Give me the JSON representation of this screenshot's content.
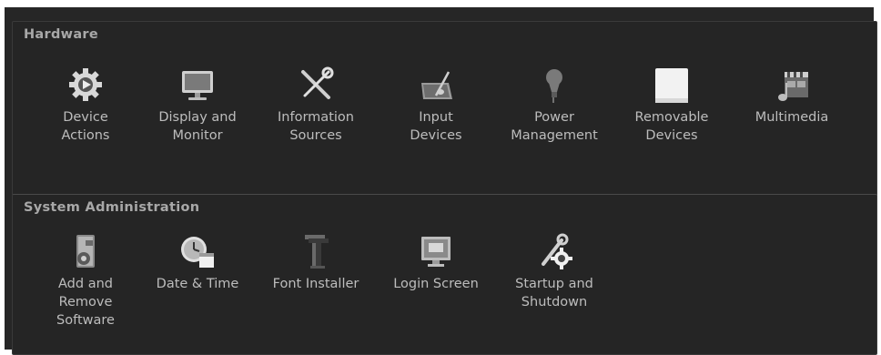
{
  "sections": {
    "hardware": {
      "title": "Hardware",
      "items": [
        {
          "label": "Device\nActions",
          "icon": "gear-play-icon"
        },
        {
          "label": "Display and\nMonitor",
          "icon": "monitor-icon"
        },
        {
          "label": "Information\nSources",
          "icon": "tools-icon"
        },
        {
          "label": "Input\nDevices",
          "icon": "tablet-pen-icon"
        },
        {
          "label": "Power\nManagement",
          "icon": "lightbulb-icon"
        },
        {
          "label": "Removable\nDevices",
          "icon": "drive-icon"
        },
        {
          "label": "Multimedia",
          "icon": "clapperboard-icon"
        }
      ]
    },
    "system": {
      "title": "System Administration",
      "items": [
        {
          "label": "Add and\nRemove\nSoftware",
          "icon": "software-package-icon"
        },
        {
          "label": "Date & Time",
          "icon": "clock-calendar-icon"
        },
        {
          "label": "Font Installer",
          "icon": "font-icon"
        },
        {
          "label": "Login Screen",
          "icon": "login-screen-icon"
        },
        {
          "label": "Startup and\nShutdown",
          "icon": "wrench-gear-icon"
        }
      ]
    }
  }
}
